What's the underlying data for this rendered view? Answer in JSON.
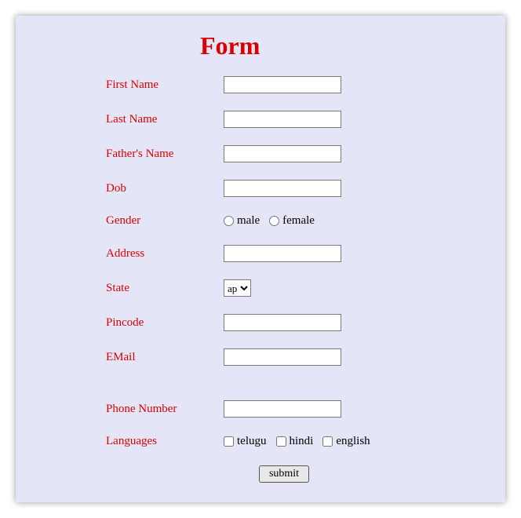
{
  "title": "Form",
  "fields": {
    "first_name": {
      "label": "First Name",
      "value": ""
    },
    "last_name": {
      "label": "Last Name",
      "value": ""
    },
    "father_name": {
      "label": "Father's Name",
      "value": ""
    },
    "dob": {
      "label": "Dob",
      "value": ""
    },
    "gender": {
      "label": "Gender",
      "options": {
        "male": "male",
        "female": "female"
      }
    },
    "address": {
      "label": "Address",
      "value": ""
    },
    "state": {
      "label": "State",
      "selected": "ap",
      "option_ap": "ap"
    },
    "pincode": {
      "label": "Pincode",
      "value": ""
    },
    "email": {
      "label": "EMail",
      "value": ""
    },
    "phone": {
      "label": "Phone Number",
      "value": ""
    },
    "languages": {
      "label": "Languages",
      "options": {
        "telugu": "telugu",
        "hindi": "hindi",
        "english": "english"
      }
    }
  },
  "submit_label": "submit"
}
